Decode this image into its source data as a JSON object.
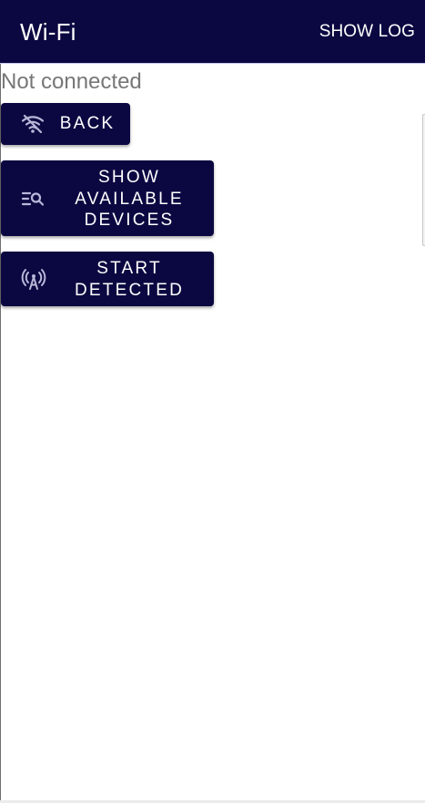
{
  "appbar": {
    "title": "Wi-Fi",
    "action_label": "SHOW LOG"
  },
  "status": {
    "text": "Not connected"
  },
  "buttons": {
    "back": {
      "label": "BACK",
      "icon": "wifi-off-icon"
    },
    "show_devices": {
      "label": "SHOW\nAVAILABLE\nDEVICES",
      "icon": "list-search-icon"
    },
    "start_detected": {
      "label": "START\nDETECTED",
      "icon": "broadcast-tower-icon"
    }
  },
  "colors": {
    "primary": "#0b0841",
    "on_primary": "#ffffff",
    "status_text": "#777777",
    "icon_tint": "#b9b7d9"
  }
}
